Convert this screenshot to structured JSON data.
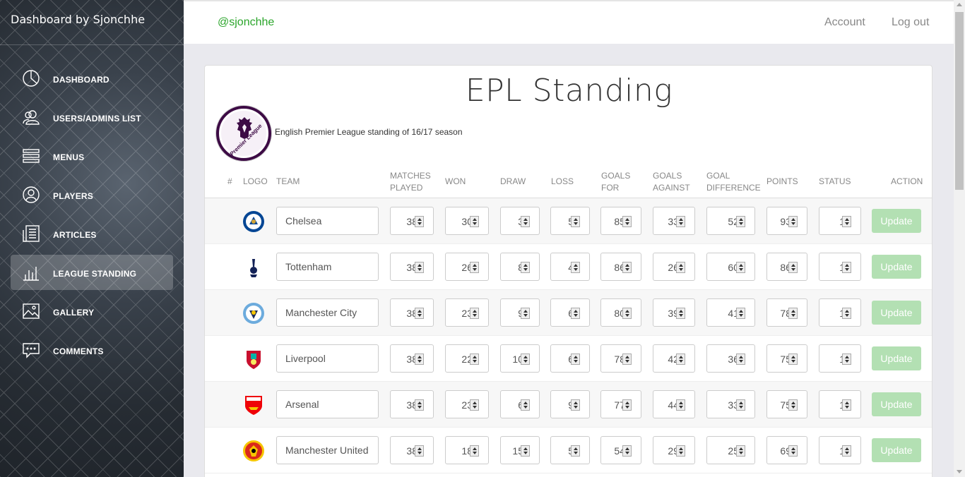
{
  "sidebar": {
    "brand": "Dashboard by Sjonchhe",
    "items": [
      {
        "label": "DASHBOARD",
        "icon": "pie-chart-icon"
      },
      {
        "label": "USERS/ADMINS LIST",
        "icon": "users-icon"
      },
      {
        "label": "MENUS",
        "icon": "menu-lines-icon"
      },
      {
        "label": "PLAYERS",
        "icon": "user-icon"
      },
      {
        "label": "ARTICLES",
        "icon": "article-icon"
      },
      {
        "label": "LEAGUE STANDING",
        "icon": "bar-chart-icon"
      },
      {
        "label": "GALLERY",
        "icon": "image-icon"
      },
      {
        "label": "COMMENTS",
        "icon": "comment-icon"
      }
    ],
    "active_item": "LEAGUE STANDING"
  },
  "topbar": {
    "handle": "@sjonchhe",
    "account": "Account",
    "logout": "Log out"
  },
  "card": {
    "title": "EPL Standing",
    "logo_text": "Premier League",
    "subtitle": "English Premier League standing of 16/17 season"
  },
  "table": {
    "headers": {
      "rank": "#",
      "logo": "LOGO",
      "team": "TEAM",
      "matches_played": [
        "MATCHES",
        "PLAYED"
      ],
      "won": "WON",
      "draw": "DRAW",
      "loss": "LOSS",
      "goals_for": [
        "GOALS",
        "FOR"
      ],
      "goals_against": [
        "GOALS",
        "AGAINST"
      ],
      "goal_difference": [
        "GOAL",
        "DIFFERENCE"
      ],
      "points": "POINTS",
      "status": "STATUS",
      "action": "ACTION"
    },
    "rows": [
      {
        "team": "Chelsea",
        "crest": "chelsea-crest",
        "played": "38",
        "won": "30",
        "draw": "3",
        "loss": "5",
        "gf": "85",
        "ga": "33",
        "gd": "52",
        "points": "93",
        "status": "1",
        "action": "Update"
      },
      {
        "team": "Tottenham",
        "crest": "tottenham-crest",
        "played": "38",
        "won": "26",
        "draw": "8",
        "loss": "4",
        "gf": "86",
        "ga": "26",
        "gd": "60",
        "points": "86",
        "status": "1",
        "action": "Update"
      },
      {
        "team": "Manchester City",
        "crest": "man-city-crest",
        "played": "38",
        "won": "23",
        "draw": "9",
        "loss": "6",
        "gf": "80",
        "ga": "39",
        "gd": "41",
        "points": "78",
        "status": "1",
        "action": "Update"
      },
      {
        "team": "Liverpool",
        "crest": "liverpool-crest",
        "played": "38",
        "won": "22",
        "draw": "10",
        "loss": "6",
        "gf": "78",
        "ga": "42",
        "gd": "36",
        "points": "75",
        "status": "1",
        "action": "Update"
      },
      {
        "team": "Arsenal",
        "crest": "arsenal-crest",
        "played": "38",
        "won": "23",
        "draw": "6",
        "loss": "9",
        "gf": "77",
        "ga": "44",
        "gd": "33",
        "points": "75",
        "status": "1",
        "action": "Update"
      },
      {
        "team": "Manchester United",
        "crest": "man-united-crest",
        "played": "38",
        "won": "18",
        "draw": "15",
        "loss": "5",
        "gf": "54",
        "ga": "29",
        "gd": "25",
        "points": "69",
        "status": "1",
        "action": "Update"
      }
    ]
  },
  "colors": {
    "handle_green": "#2aa52a",
    "update_button": "#b3e0b3",
    "premier_league_purple": "#3d0b45"
  }
}
